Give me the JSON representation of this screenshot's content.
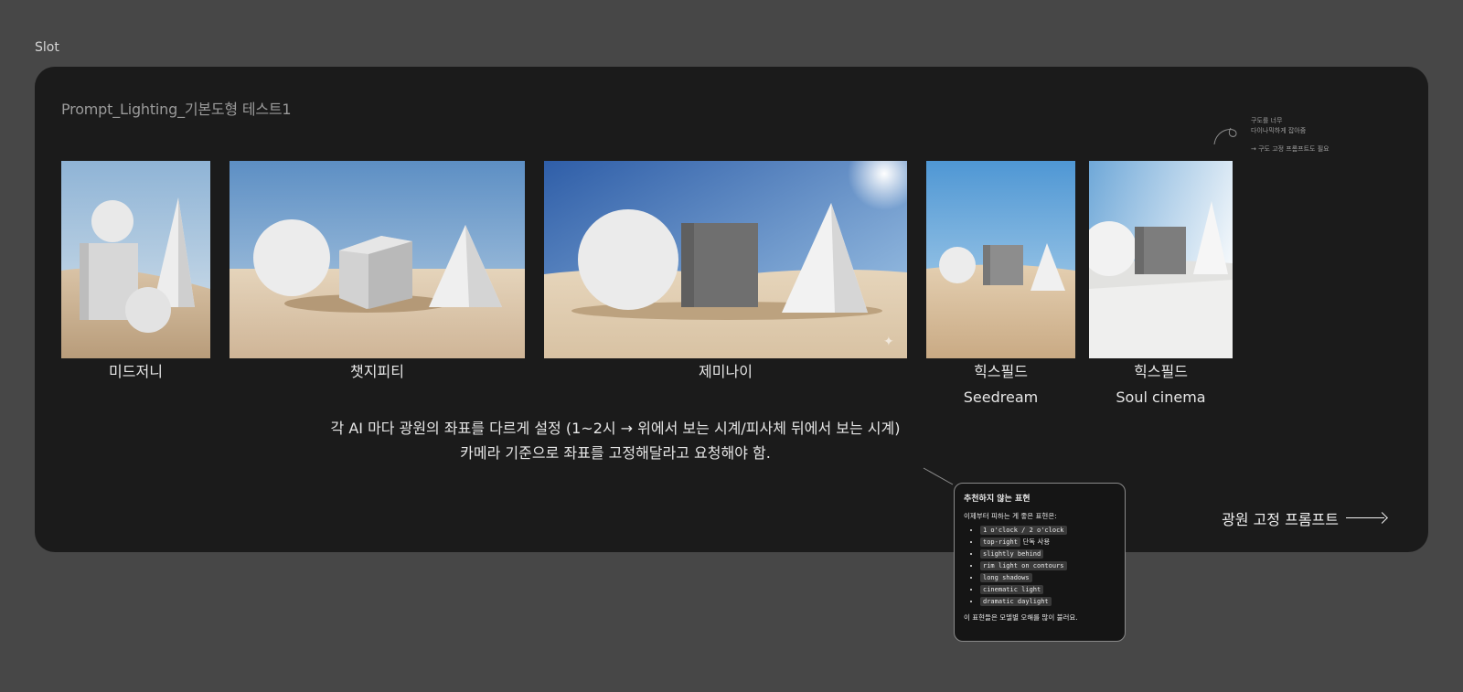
{
  "canvas": {
    "slot_label": "Slot"
  },
  "frame": {
    "title": "Prompt_Lighting_기본도형 테스트1",
    "images": [
      {
        "label": "미드저니",
        "sublabel": ""
      },
      {
        "label": "챗지피티",
        "sublabel": ""
      },
      {
        "label": "제미나이",
        "sublabel": ""
      },
      {
        "label": "힉스필드",
        "sublabel": "Seedream"
      },
      {
        "label": "힉스필드",
        "sublabel": "Soul cinema"
      }
    ],
    "note_line1": "각 AI 마다 광원의 좌표를 다르게 설정 (1~2시 → 위에서 보는 시계/피사체 뒤에서 보는 시계)",
    "note_line2": "카메라 기준으로 좌표를 고정해달라고 요청해야 함.",
    "cta_label": "광원 고정 프롬프트",
    "side_note": {
      "line1": "구도를 너무",
      "line2": "다이나믹하게 잡아줌",
      "line3": "→ 구도 고정 프롬프트도 필요"
    }
  },
  "tooltip": {
    "title": "추천하지 않는 표현",
    "intro": "이제부터 피하는 게 좋은 표현은:",
    "items": [
      {
        "code": "1 o'clock / 2 o'clock",
        "suffix": ""
      },
      {
        "code": "top-right",
        "suffix": " 단독 사용"
      },
      {
        "code": "slightly behind",
        "suffix": ""
      },
      {
        "code": "rim light on contours",
        "suffix": ""
      },
      {
        "code": "long shadows",
        "suffix": ""
      },
      {
        "code": "cinematic light",
        "suffix": ""
      },
      {
        "code": "dramatic daylight",
        "suffix": ""
      }
    ],
    "footer": "이 표현들은 모델별 오해를 많이 불러요."
  },
  "colors": {
    "canvas": "#474747",
    "frame": "#1b1b1b",
    "text": "#e6e6e6"
  }
}
